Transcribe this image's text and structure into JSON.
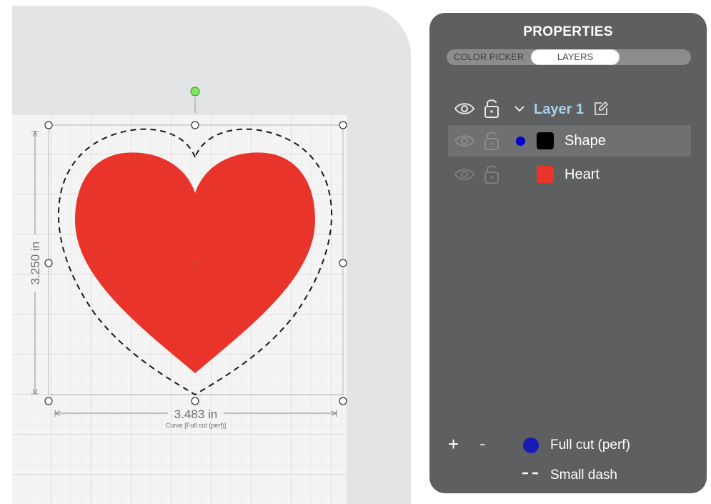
{
  "canvas": {
    "width_label": "3.483 in",
    "height_label": "3.250 in",
    "selection_caption": "Curve [Full cut (perf)]"
  },
  "properties": {
    "title": "PROPERTIES",
    "tabs": [
      {
        "label": "COLOR PICKER",
        "active": false
      },
      {
        "label": "LAYERS",
        "active": true
      }
    ],
    "layer": {
      "name": "Layer 1",
      "items": [
        {
          "label": "Shape",
          "color": "#000000",
          "dot_color": "#0000cc",
          "selected": true
        },
        {
          "label": "Heart",
          "color": "#e8342a",
          "selected": false
        }
      ]
    },
    "footer": {
      "add_label": "+",
      "remove_label": "-",
      "cut_type": "Full cut  (perf)",
      "cut_color": "#1a1ab8",
      "line_style": "Small dash"
    }
  },
  "colors": {
    "heart": "#e8342a",
    "accent_layer": "#a3d2ec",
    "rotate_handle": "#7ce85c"
  }
}
